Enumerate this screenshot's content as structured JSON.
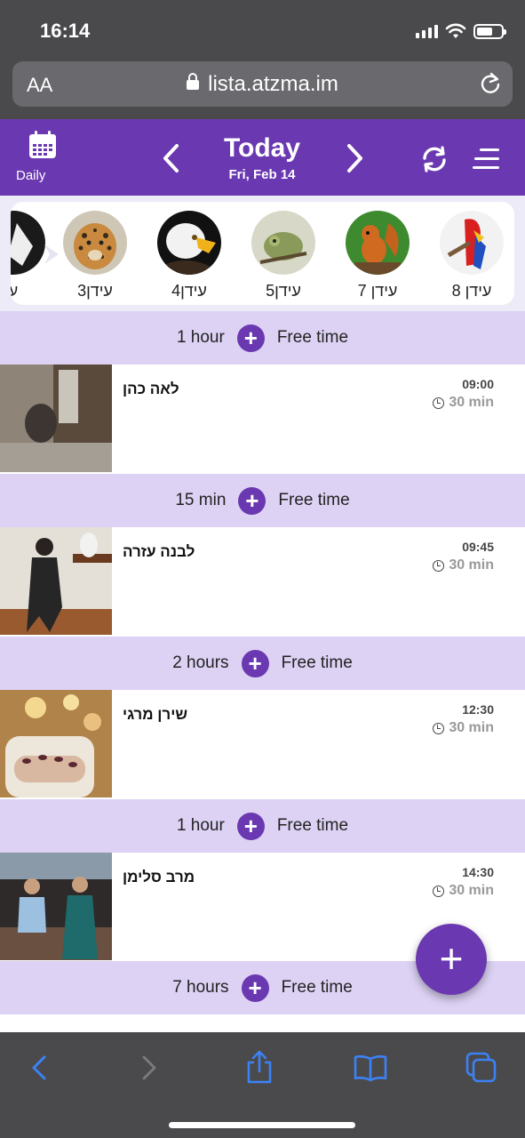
{
  "status_bar": {
    "time": "16:14"
  },
  "browser": {
    "text_size_label": "AA",
    "url": "lista.atzma.im"
  },
  "header": {
    "view_label": "Daily",
    "title": "Today",
    "date": "Fri, Feb 14"
  },
  "staff": [
    {
      "name": "ע",
      "icon": "wolf-avatar"
    },
    {
      "name": "עידן3",
      "icon": "leopard-avatar"
    },
    {
      "name": "עידן4",
      "icon": "eagle-avatar"
    },
    {
      "name": "עידן5",
      "icon": "chameleon-avatar"
    },
    {
      "name": "עידן 7",
      "icon": "squirrel-avatar"
    },
    {
      "name": "עידן 8",
      "icon": "parrot-avatar"
    }
  ],
  "schedule": {
    "free_time_label": "Free time",
    "free_slots": [
      {
        "duration": "1 hour"
      },
      {
        "duration": "15 min"
      },
      {
        "duration": "2 hours"
      },
      {
        "duration": "1 hour"
      },
      {
        "duration": "7 hours"
      }
    ],
    "appointments": [
      {
        "client": "לאה כהן",
        "time": "09:00",
        "duration": "30 min"
      },
      {
        "client": "לבנה עזרה",
        "time": "09:45",
        "duration": "30 min"
      },
      {
        "client": "שירן מרגי",
        "time": "12:30",
        "duration": "30 min"
      },
      {
        "client": "מרב סלימן",
        "time": "14:30",
        "duration": "30 min"
      }
    ]
  },
  "colors": {
    "brand": "#6a38b0",
    "free_slot": "#ddd2f4",
    "browser_chrome": "#4a4a4c"
  }
}
